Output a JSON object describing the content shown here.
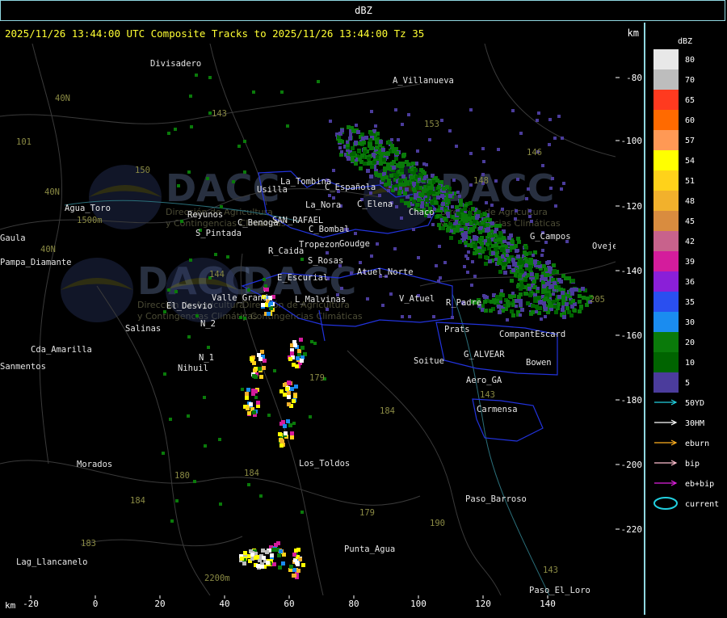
{
  "header": {
    "unit_label": "dBZ"
  },
  "title": {
    "text": "2025/11/26 13:44:00 UTC Composite Tracks to 2025/11/26 13:44:00 Tz 35",
    "km_label": "km"
  },
  "axes": {
    "x_label": "km",
    "x_ticks": [
      "-20",
      "0",
      "20",
      "40",
      "60",
      "80",
      "100",
      "120",
      "140"
    ],
    "y_ticks": [
      "-80",
      "-100",
      "-120",
      "-140",
      "-160",
      "-180",
      "-200",
      "-220"
    ]
  },
  "watermark": {
    "brand": "DACC",
    "line1": "Dirección de Agricultura",
    "line2": "y Contingencias Climáticas"
  },
  "legend": {
    "title": "dBZ",
    "scale": [
      {
        "label": "80",
        "color": "#e8e8e8"
      },
      {
        "label": "70",
        "color": "#bdbdbd"
      },
      {
        "label": "65",
        "color": "#ff3a1f"
      },
      {
        "label": "60",
        "color": "#ff6a00"
      },
      {
        "label": "57",
        "color": "#ff9955"
      },
      {
        "label": "54",
        "color": "#ffff00"
      },
      {
        "label": "51",
        "color": "#ffd21a"
      },
      {
        "label": "48",
        "color": "#f2b12c"
      },
      {
        "label": "45",
        "color": "#d98c3f"
      },
      {
        "label": "42",
        "color": "#c8628c"
      },
      {
        "label": "39",
        "color": "#d41c9c"
      },
      {
        "label": "36",
        "color": "#8a1fd8"
      },
      {
        "label": "35",
        "color": "#2a4ff0"
      },
      {
        "label": "30",
        "color": "#1a8cf0"
      },
      {
        "label": "20",
        "color": "#0a7a0a"
      },
      {
        "label": "10",
        "color": "#006400"
      },
      {
        "label": "5",
        "color": "#4b3c9c"
      }
    ],
    "tracks": [
      {
        "label": "50YD",
        "color": "#22d0e0"
      },
      {
        "label": "30HM",
        "color": "#ffffff"
      },
      {
        "label": "eburn",
        "color": "#ffb020"
      },
      {
        "label": "bip",
        "color": "#ffc0d0"
      },
      {
        "label": "eb+bip",
        "color": "#e020e0"
      },
      {
        "label": "current",
        "color": "#22d0e0"
      }
    ]
  },
  "map": {
    "places": [
      "Divisadero",
      "A_Villanueva",
      "La_Tombina",
      "Usilla",
      "C_Española",
      "La_Nora",
      "C_Elena",
      "Goudge",
      "Chaco",
      "C_Benoga",
      "SAN_RAFAEL",
      "C_Bombal",
      "Reyunos",
      "S_Pintada",
      "Agua_Toro",
      "Gaula",
      "Pampa_Diamante",
      "Tropezon",
      "R_Caida",
      "S_Rosas",
      "Atuel_Norte",
      "E_Escurial",
      "Valle_Grande",
      "L_Malvinas",
      "V_Atuel",
      "R_Padre",
      "El_Desvio",
      "Salinas",
      "N_2",
      "N_1",
      "Cda_Amarilla",
      "Nihuil",
      "Sanmentos",
      "Prats",
      "CompantEscard",
      "G_ALVEAR",
      "Bowen",
      "Soitue",
      "Aero_GA",
      "Carmensa",
      "Los_Toldos",
      "Morados",
      "Paso_Barroso",
      "Punta_Agua",
      "Lag_Llancanelo",
      "Paso_El_Loro",
      "G_Campos",
      "Ovejero"
    ],
    "route_labels": [
      "143",
      "153",
      "146",
      "150",
      "148",
      "101",
      "40N",
      "40N",
      "40N",
      "144",
      "179",
      "184",
      "180",
      "184",
      "184",
      "183",
      "179",
      "190",
      "143",
      "143",
      "205",
      "1500m",
      "2200m"
    ]
  }
}
